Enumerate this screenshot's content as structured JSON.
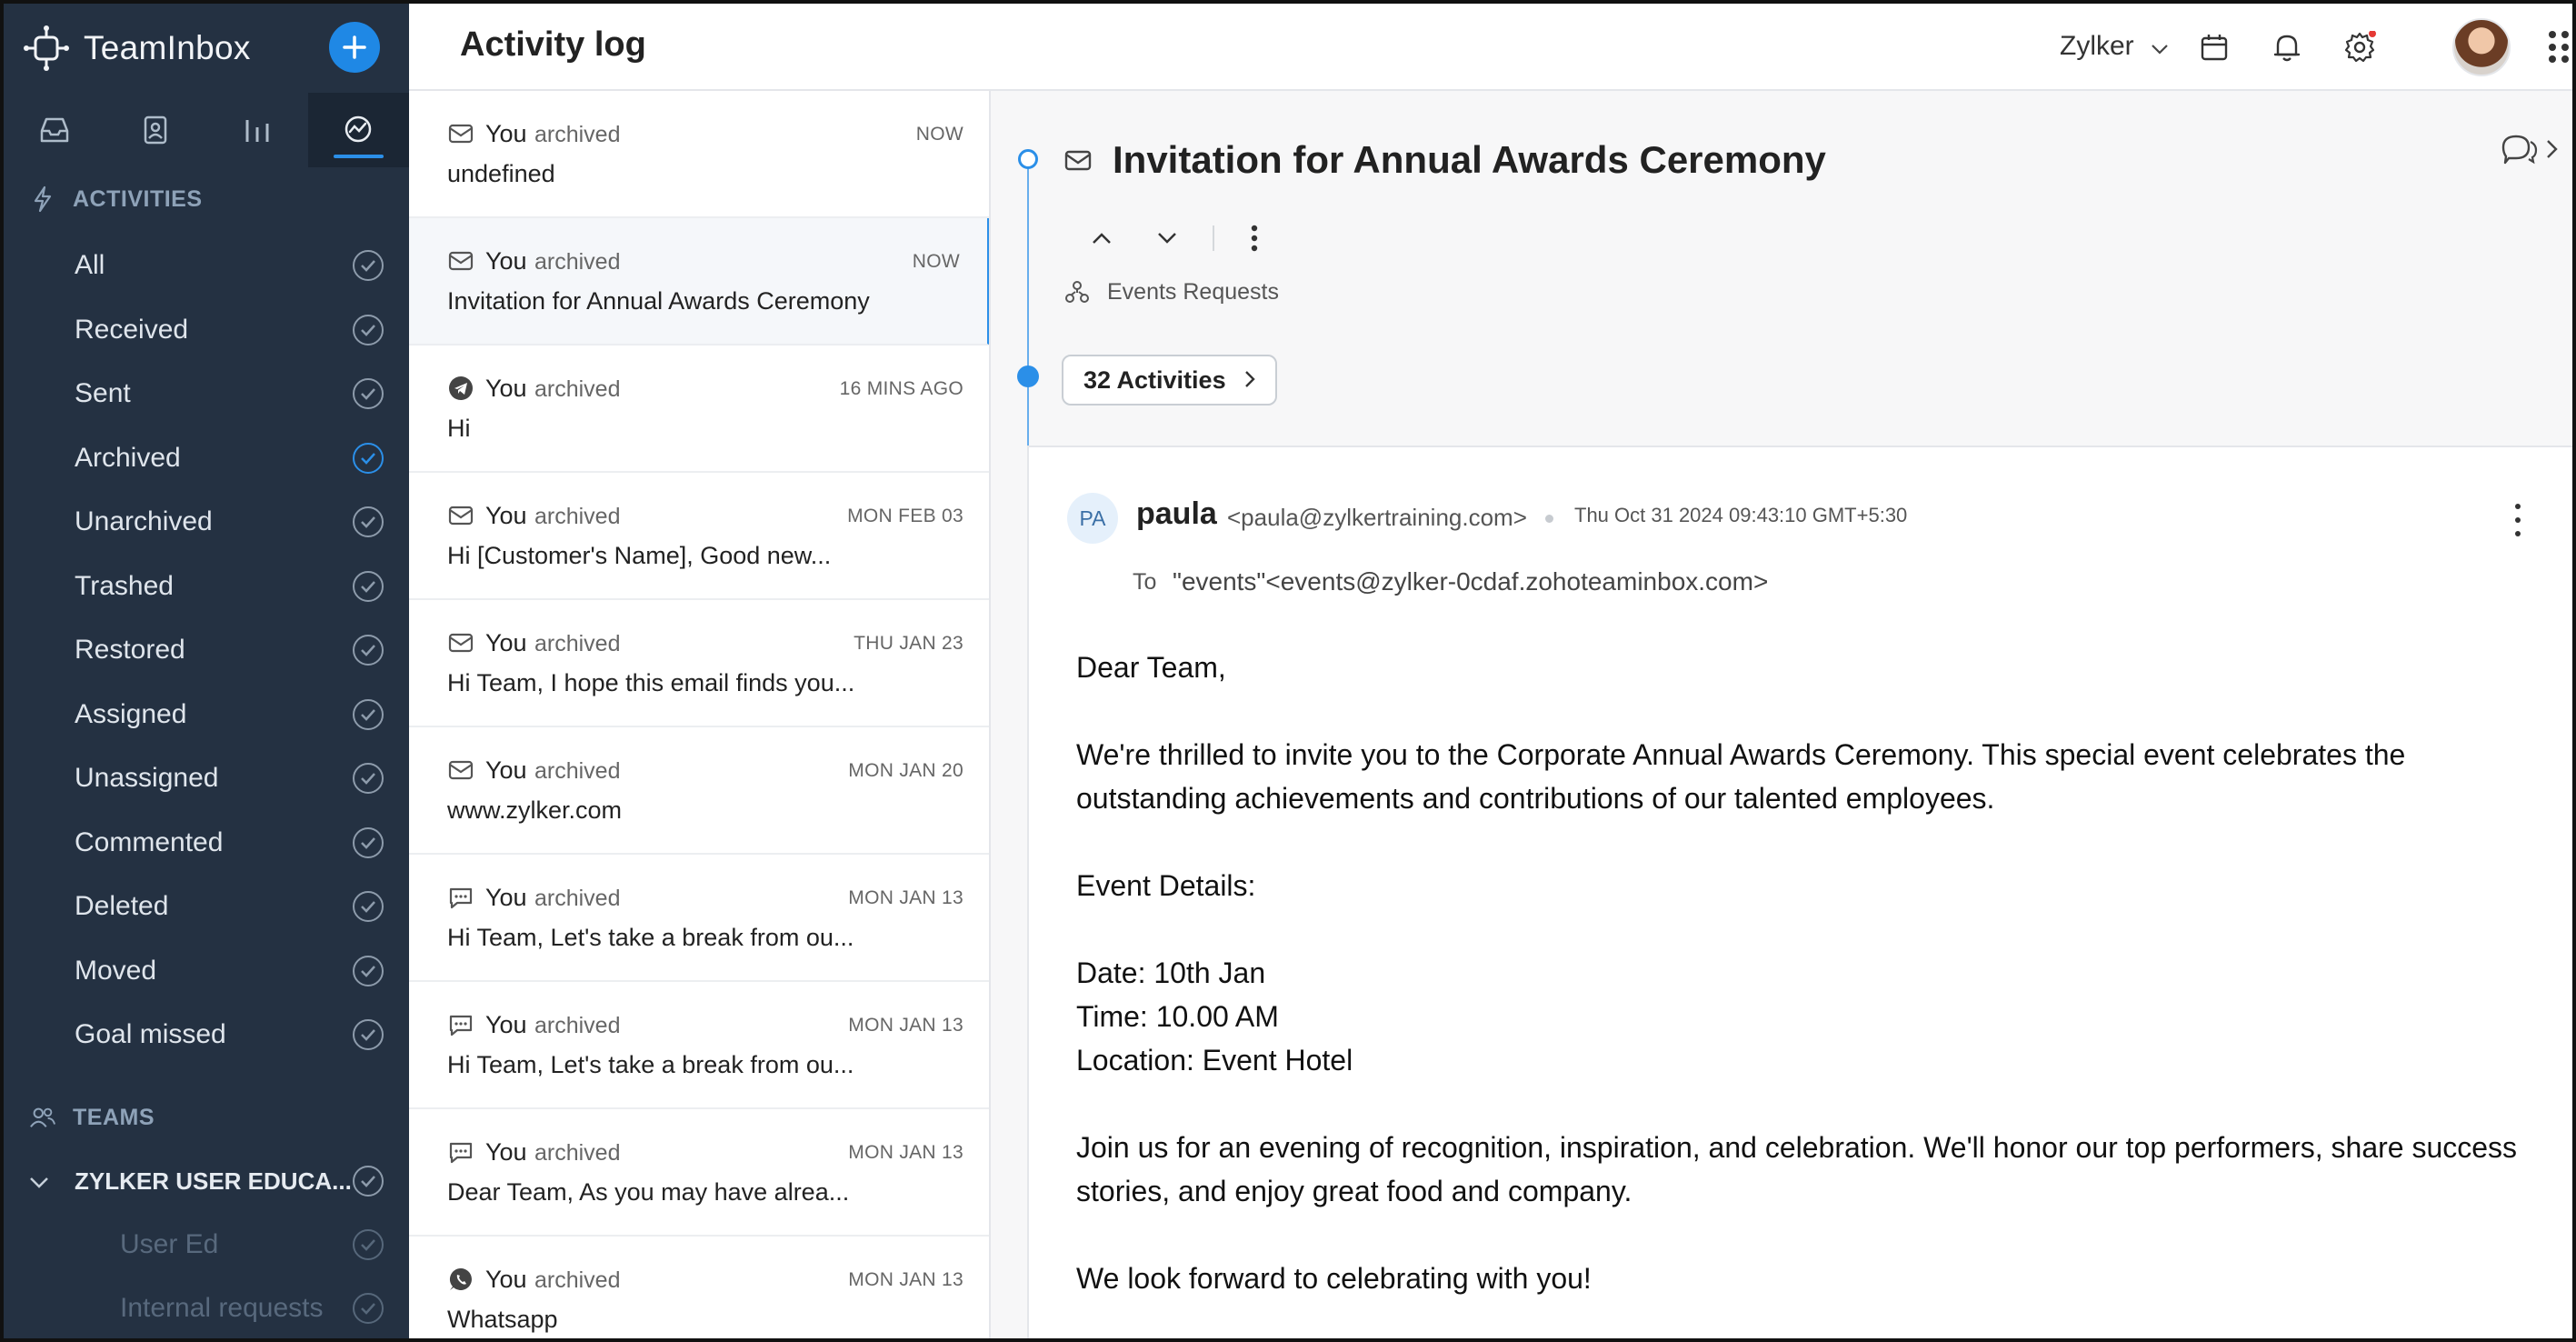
{
  "app": {
    "name": "TeamInbox",
    "page_title": "Activity log",
    "org_name": "Zylker",
    "accent": "#1f88e5",
    "sidebar_bg": "#243142"
  },
  "sidebar": {
    "tabs": [
      {
        "icon": "inbox-icon"
      },
      {
        "icon": "contacts-icon"
      },
      {
        "icon": "reports-icon"
      },
      {
        "icon": "activity-icon",
        "active": true
      }
    ],
    "activities_heading": "ACTIVITIES",
    "activities": [
      {
        "label": "All",
        "checked": false
      },
      {
        "label": "Received",
        "checked": false
      },
      {
        "label": "Sent",
        "checked": false
      },
      {
        "label": "Archived",
        "checked": true
      },
      {
        "label": "Unarchived",
        "checked": false
      },
      {
        "label": "Trashed",
        "checked": false
      },
      {
        "label": "Restored",
        "checked": false
      },
      {
        "label": "Assigned",
        "checked": false
      },
      {
        "label": "Unassigned",
        "checked": false
      },
      {
        "label": "Commented",
        "checked": false
      },
      {
        "label": "Deleted",
        "checked": false
      },
      {
        "label": "Moved",
        "checked": false
      },
      {
        "label": "Goal missed",
        "checked": false
      }
    ],
    "teams_heading": "TEAMS",
    "team_name": "ZYLKER USER EDUCA...",
    "team_inboxes": [
      "User Ed",
      "Internal requests"
    ]
  },
  "list": {
    "items": [
      {
        "icon": "mail-icon",
        "actor": "You",
        "action": "archived",
        "time": "NOW",
        "subject": "undefined"
      },
      {
        "icon": "mail-icon",
        "actor": "You",
        "action": "archived",
        "time": "NOW",
        "subject": "Invitation for Annual Awards Ceremony",
        "selected": true
      },
      {
        "icon": "telegram-icon",
        "actor": "You",
        "action": "archived",
        "time": "16 MINS AGO",
        "subject": "Hi"
      },
      {
        "icon": "mail-icon",
        "actor": "You",
        "action": "archived",
        "time": "MON FEB 03",
        "subject": "Hi [Customer's Name], Good new..."
      },
      {
        "icon": "mail-icon",
        "actor": "You",
        "action": "archived",
        "time": "THU JAN 23",
        "subject": "Hi Team, I hope this email finds you..."
      },
      {
        "icon": "mail-icon",
        "actor": "You",
        "action": "archived",
        "time": "MON JAN 20",
        "subject": "www.zylker.com"
      },
      {
        "icon": "chat-icon",
        "actor": "You",
        "action": "archived",
        "time": "MON JAN 13",
        "subject": "Hi Team, Let's take a break from ou..."
      },
      {
        "icon": "chat-icon",
        "actor": "You",
        "action": "archived",
        "time": "MON JAN 13",
        "subject": "Hi Team, Let's take a break from ou..."
      },
      {
        "icon": "chat-icon",
        "actor": "You",
        "action": "archived",
        "time": "MON JAN 13",
        "subject": "Dear Team, As you may have alrea..."
      },
      {
        "icon": "whatsapp-icon",
        "actor": "You",
        "action": "archived",
        "time": "MON JAN 13",
        "subject": "Whatsapp"
      }
    ]
  },
  "detail": {
    "title": "Invitation for Annual Awards Ceremony",
    "department": "Events Requests",
    "activities_button": "32 Activities",
    "message": {
      "avatar_initials": "PA",
      "from_name": "paula",
      "from_email": "<paula@zylkertraining.com>",
      "date": "Thu Oct 31 2024 09:43:10 GMT+5:30",
      "to_label": "To",
      "to_address": "\"events\"<events@zylker-0cdaf.zohoteaminbox.com>",
      "body": [
        "Dear Team,",
        "",
        "We're thrilled to invite you to the Corporate Annual Awards Ceremony. This special event celebrates the outstanding achievements and contributions of our talented employees.",
        "",
        "Event Details:",
        "",
        "Date: 10th Jan",
        "Time: 10.00 AM",
        "Location: Event Hotel",
        "",
        "Join us for an evening of recognition, inspiration, and celebration. We'll honor our top performers, share success stories, and enjoy great food and company.",
        "",
        "We look forward to celebrating with you!"
      ]
    }
  }
}
